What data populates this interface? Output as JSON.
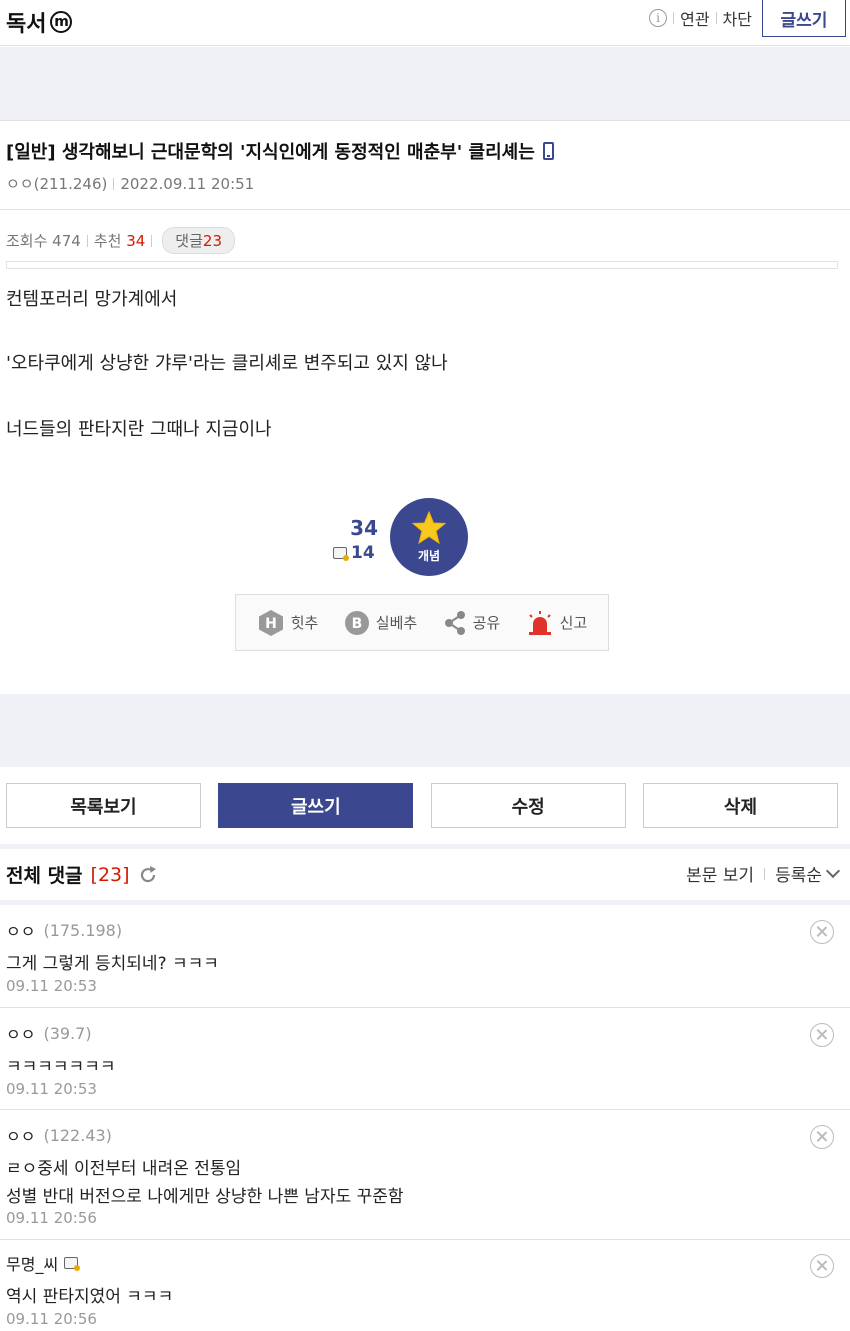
{
  "header": {
    "gallery_name": "독서",
    "minor_mark": "m",
    "info_icon": "info-icon",
    "related_label": "연관",
    "block_label": "차단",
    "write_label": "글쓰기"
  },
  "post": {
    "title": "[일반] 생각해보니 근대문학의 '지식인에게 동정적인 매춘부' 클리셰는",
    "author": "ㅇㅇ(211.246)",
    "datetime": "2022.09.11 20:51",
    "views_label": "조회수 474",
    "recommend_label": "추천",
    "recommend_value": "34",
    "reply_label": "댓글",
    "reply_value": "23",
    "body": [
      "컨템포러리 망가계에서",
      "'오타쿠에게 상냥한 갸루'라는 클리셰로 변주되고 있지 않나",
      "너드들의 판타지란 그때나 지금이나"
    ]
  },
  "recommend": {
    "count": "34",
    "fixed_count": "14",
    "button_label": "개념",
    "star_color": "#f7c81e",
    "button_color": "#3b4890"
  },
  "actions": {
    "hit": "힛추",
    "silbe": "실베추",
    "share": "공유",
    "report": "신고"
  },
  "buttons": {
    "list": "목록보기",
    "write": "글쓰기",
    "edit": "수정",
    "delete": "삭제"
  },
  "comments_header": {
    "title": "전체 댓글",
    "count": "[23]",
    "view_body": "본문 보기",
    "sort": "등록순"
  },
  "comments": [
    {
      "name": "ㅇㅇ",
      "ip": "(175.198)",
      "lines": [
        "그게 그렇게 등치되네? ㅋㅋㅋ"
      ],
      "date": "09.11 20:53"
    },
    {
      "name": "ㅇㅇ",
      "ip": "(39.7)",
      "lines": [
        "ㅋㅋㅋㅋㅋㅋㅋ"
      ],
      "date": "09.11 20:53"
    },
    {
      "name": "ㅇㅇ",
      "ip": "(122.43)",
      "lines": [
        "ㄹㅇ중세 이전부터 내려온 전통임",
        "성별 반대 버전으로 나에게만 상냥한 나쁜 남자도 꾸준함"
      ],
      "date": "09.11 20:56"
    },
    {
      "name": "무명_씨",
      "ip": "",
      "lines": [
        "역시 판타지였어 ㅋㅋㅋ"
      ],
      "date": "09.11 20:56"
    }
  ]
}
